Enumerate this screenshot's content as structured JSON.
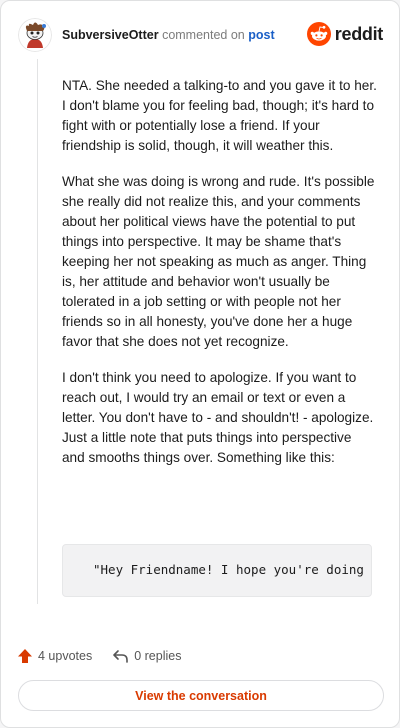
{
  "comment": {
    "username": "SubversiveOtter",
    "verb": "commented on",
    "post_link": "post",
    "paragraphs": [
      "NTA. She needed a talking-to and you gave it to her. I don't blame you for feeling bad, though; it's hard to fight with or potentially lose a friend. If your friendship is solid, though, it will weather this.",
      "What she was doing is wrong and rude. It's possible she really did not realize this, and your comments about her political views have the potential to put things into perspective. It may be shame that's keeping her not speaking as much as anger. Thing is, her attitude and behavior won't usually be tolerated in a job setting or with people not her friends so in all honesty, you've done her a huge favor that she does not yet recognize.",
      "I don't think you need to apologize. If you want to reach out, I would try an email or text or even a letter. You don't have to - and shouldn't! - apologize. Just a little note that puts things into perspective and smooths things over. Something like this:"
    ],
    "code": "\"Hey Friendname! I hope you're doing"
  },
  "brand": {
    "name": "reddit",
    "icon": "reddit-logo-icon",
    "color": "#ff4500"
  },
  "actions": {
    "upvotes": "4 upvotes",
    "replies": "0 replies"
  },
  "view_button": "View the conversation",
  "colors": {
    "accent": "#d93a00",
    "link": "#1a5fc7",
    "upvote": "#d93a00"
  }
}
